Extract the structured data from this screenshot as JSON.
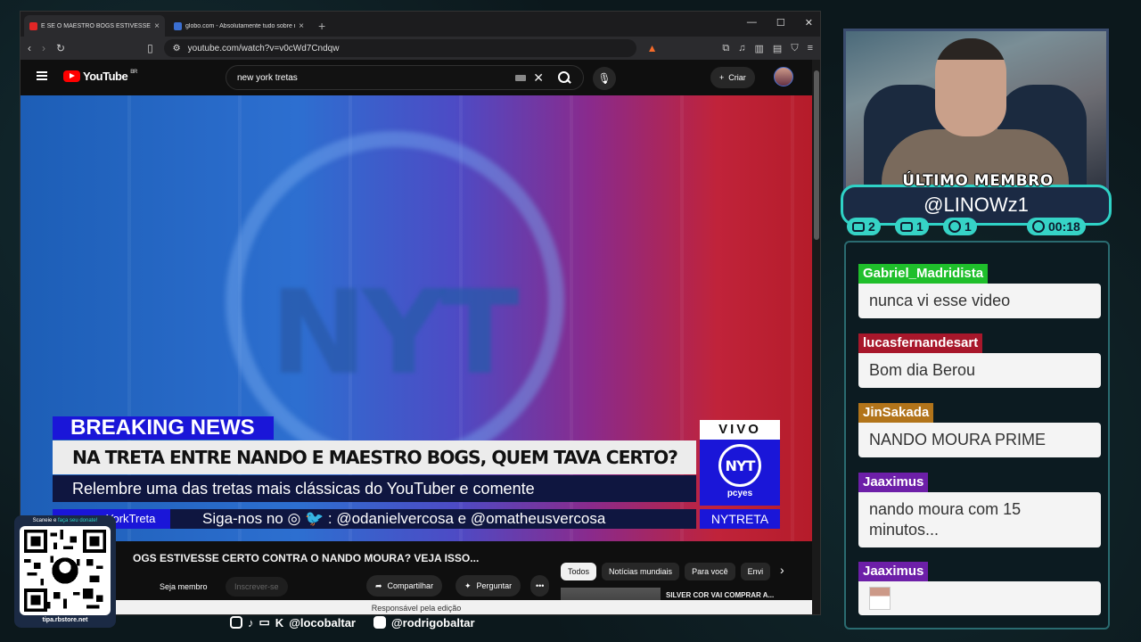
{
  "browser": {
    "tabs": [
      {
        "title": "E SE O MAESTRO BOGS ESTIVESSE",
        "favicon_color": "#e02626",
        "active": true
      },
      {
        "title": "globo.com - Absolutamente tudo sobre not",
        "favicon_color": "#3b6fd1",
        "active": false
      }
    ],
    "new_tab": "+",
    "url": "youtube.com/watch?v=v0cWd7Cndqw"
  },
  "youtube": {
    "logo_text": "YouTube",
    "region": "BR",
    "search_value": "new york tretas",
    "create_label": "Criar"
  },
  "video": {
    "breaking": "BREAKING NEWS",
    "headline": "NA TRETA ENTRE NANDO E MAESTRO BOGS, QUEM TAVA CERTO?",
    "subline": "Relembre uma das tretas mais clássicas do YouTuber e comente",
    "vivo": "VIVO",
    "vivo_logo": "NYT",
    "vivo_brand": "pcyes",
    "ticker_tag": "YorkTreta",
    "ticker_text": "Siga-nos no ◎ 🐦 : @odanielvercosa e @omatheusvercosa",
    "ticker_right": "NYTRETA"
  },
  "below": {
    "title": "OGS ESTIVESSE CERTO CONTRA O NANDO MOURA? VEJA ISSO...",
    "join_label": "Seja membro",
    "subscribe_label": "Inscrever-se",
    "share_label": "Compartilhar",
    "ask_label": "Perguntar",
    "more_label": "•••",
    "chips": [
      "Todos",
      "Notícias mundiais",
      "Para você",
      "Envi"
    ],
    "rec_title": "SILVER COR VAI COMPRAR A...",
    "footer_tip": "Responsável pela edição"
  },
  "stream": {
    "member_label": "ÚLTIMO MEMBRO",
    "member_name": "@LINOWz1",
    "stats": [
      {
        "icon": "twitch-icon",
        "value": "2"
      },
      {
        "icon": "youtube-icon",
        "value": "1"
      },
      {
        "icon": "kick-icon",
        "value": "1"
      },
      {
        "icon": "clock-icon",
        "value": "00:18"
      }
    ],
    "chat": [
      {
        "user": "Gabriel_Madridista",
        "color": "#1fbf2b",
        "text": "nunca vi esse video"
      },
      {
        "user": "lucasfernandesart",
        "color": "#a8172b",
        "text": "Bom dia Berou"
      },
      {
        "user": "JinSakada",
        "color": "#b2741a",
        "text": "NANDO MOURA PRIME"
      },
      {
        "user": "Jaaximus",
        "color": "#6d1fa8",
        "text": "nando moura com 15 minutos..."
      },
      {
        "user": "Jaaximus",
        "color": "#6d1fa8",
        "text": ""
      }
    ],
    "qr_top_a": "Scaneie e ",
    "qr_top_b": "faça seu donate!",
    "qr_url": "tipa.rbstore.net",
    "socials": [
      "@locobaltar",
      "@rodrigobaltar"
    ]
  }
}
